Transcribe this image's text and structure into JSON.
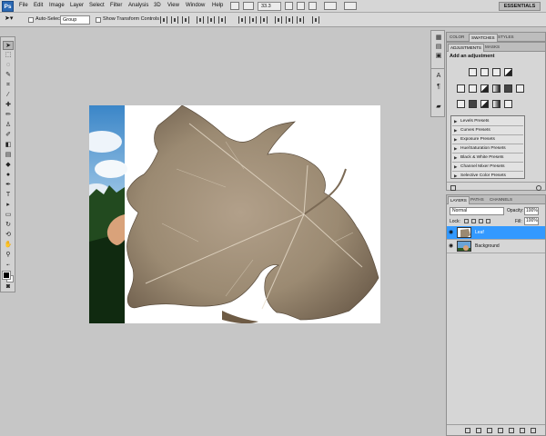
{
  "app": {
    "logo": "Ps",
    "workspace": "ESSENTIALS",
    "zoom": "33.3"
  },
  "menu": [
    "File",
    "Edit",
    "Image",
    "Layer",
    "Select",
    "Filter",
    "Analysis",
    "3D",
    "View",
    "Window",
    "Help"
  ],
  "options_bar": {
    "auto_select_label": "Auto-Select:",
    "auto_select_value": "Group",
    "show_transform_label": "Show Transform Controls"
  },
  "panels": {
    "color_tabs": [
      "COLOR",
      "SWATCHES",
      "STYLES"
    ],
    "adjustment_tabs": [
      "ADJUSTMENTS",
      "MASKS"
    ],
    "adjustments": {
      "title": "Add an adjustment",
      "presets": [
        "Levels Presets",
        "Curves Presets",
        "Exposure Presets",
        "Hue/Saturation Presets",
        "Black & White Presets",
        "Channel Mixer Presets",
        "Selective Color Presets"
      ]
    },
    "layers_tabs": [
      "LAYERS",
      "PATHS",
      "CHANNELS"
    ],
    "layers": {
      "blend_mode": "Normal",
      "opacity_label": "Opacity:",
      "opacity": "100%",
      "lock_label": "Lock:",
      "fill_label": "Fill:",
      "fill": "100%",
      "items": [
        {
          "name": "Leaf",
          "selected": true
        },
        {
          "name": "Background",
          "selected": false
        }
      ]
    }
  },
  "colors": {
    "selection": "#3399ff",
    "ps_blue": "#2b69b4",
    "canvas_bg": "#c6c6c6"
  }
}
